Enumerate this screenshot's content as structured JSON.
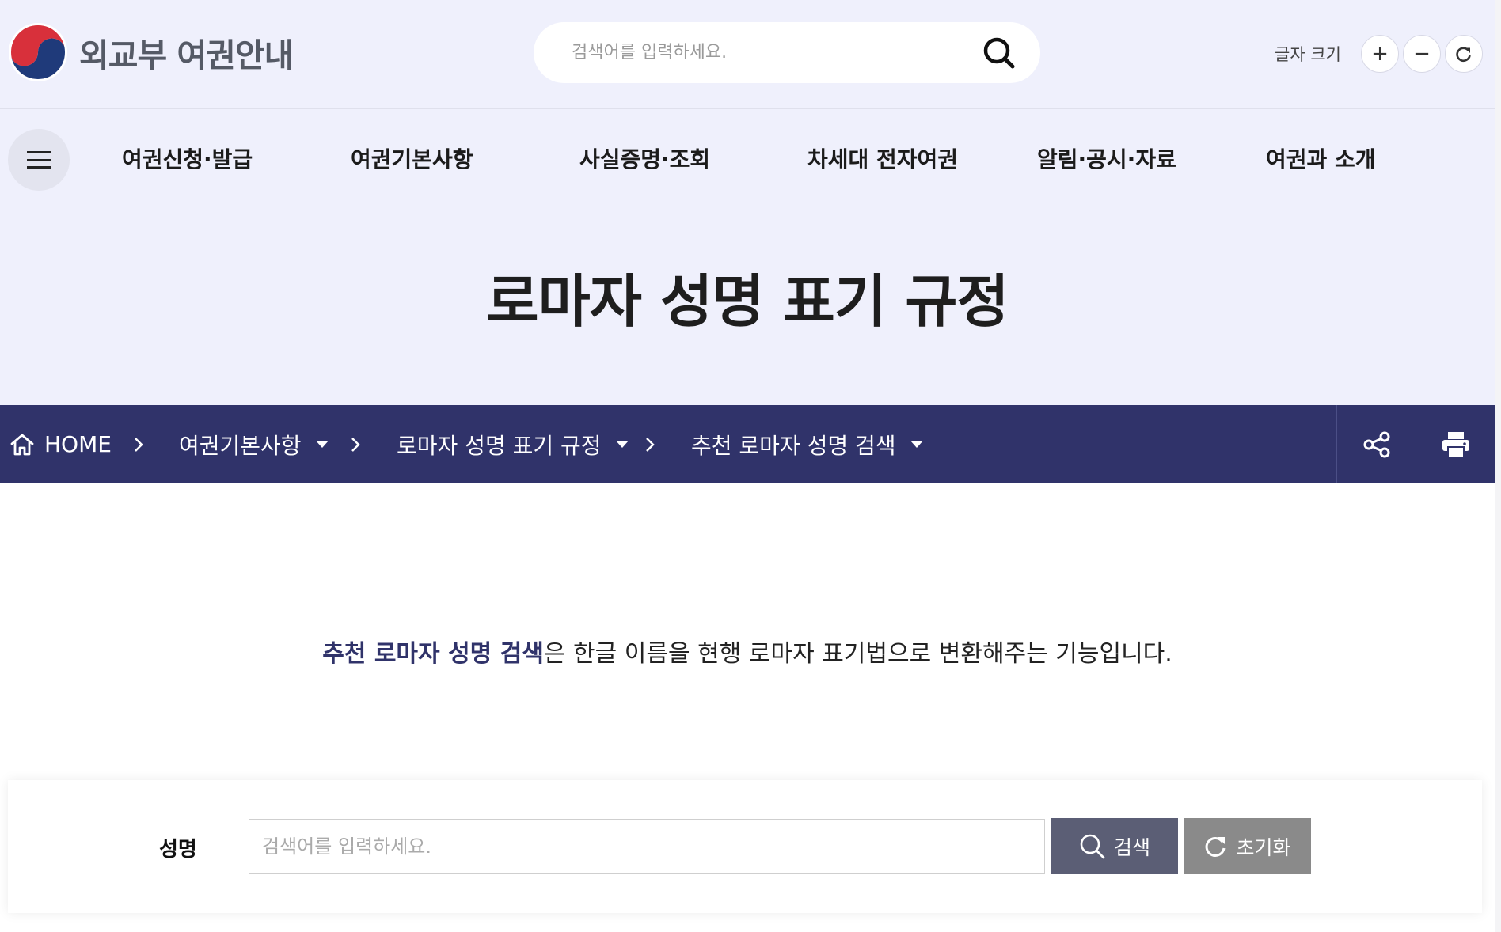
{
  "header": {
    "logo_text": "외교부 여권안내",
    "search_placeholder": "검색어를 입력하세요.",
    "font_size_label": "글자 크기",
    "font_size_buttons": {
      "increase": "+",
      "decrease": "−"
    }
  },
  "gnb": {
    "items": [
      {
        "label": "여권신청·발급"
      },
      {
        "label": "여권기본사항"
      },
      {
        "label": "사실증명·조회"
      },
      {
        "label": "차세대 전자여권"
      },
      {
        "label": "알림·공시·자료"
      },
      {
        "label": "여권과 소개"
      }
    ]
  },
  "page": {
    "title": "로마자 성명 표기 규정"
  },
  "breadcrumb": {
    "home": "HOME",
    "items": [
      {
        "label": "여권기본사항"
      },
      {
        "label": "로마자 성명 표기 규정"
      },
      {
        "label": "추천 로마자 성명 검색"
      }
    ],
    "tools": {
      "share_icon": "share-icon",
      "print_icon": "printer-icon"
    }
  },
  "intro": {
    "highlight": "추천 로마자 성명 검색",
    "rest": "은 한글 이름을 현행 로마자 표기법으로 변환해주는 기능입니다."
  },
  "search_form": {
    "label": "성명",
    "placeholder": "검색어를 입력하세요.",
    "value": "",
    "search_button": "검색",
    "reset_button": "초기화"
  },
  "colors": {
    "header_bg": "#eff0fc",
    "breadcrumb_bg": "#30336a",
    "highlight_text": "#30336a",
    "search_button_bg": "#5b5e75",
    "reset_button_bg": "#8a8a8a"
  }
}
